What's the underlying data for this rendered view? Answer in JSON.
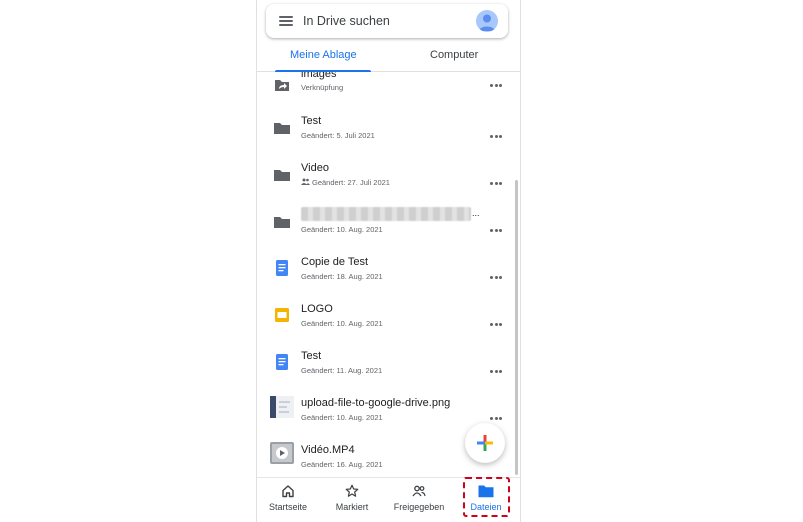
{
  "search": {
    "placeholder": "In Drive suchen"
  },
  "tabs": [
    {
      "label": "Meine Ablage",
      "active": true
    },
    {
      "label": "Computer",
      "active": false
    }
  ],
  "files": [
    {
      "name": "images",
      "sub": "Verknüpfung",
      "icon": "shortcut-icon",
      "shared": false
    },
    {
      "name": "Test",
      "sub": "Geändert: 5. Juli 2021",
      "icon": "folder-icon",
      "shared": false
    },
    {
      "name": "Video",
      "sub": "Geändert: 27. Juli 2021",
      "icon": "folder-icon",
      "shared": true
    },
    {
      "name": "...",
      "sub": "Geändert: 10. Aug. 2021",
      "icon": "folder-icon",
      "shared": false,
      "redacted": true
    },
    {
      "name": "Copie de Test",
      "sub": "Geändert: 18. Aug. 2021",
      "icon": "docs-icon",
      "shared": false
    },
    {
      "name": "LOGO",
      "sub": "Geändert: 10. Aug. 2021",
      "icon": "slides-icon",
      "shared": false
    },
    {
      "name": "Test",
      "sub": "Geändert: 11. Aug. 2021",
      "icon": "docs-icon",
      "shared": false
    },
    {
      "name": "upload-file-to-google-drive.png",
      "sub": "Geändert: 10. Aug. 2021",
      "icon": "image-thumbnail-icon",
      "shared": false
    },
    {
      "name": "Vidéo.MP4",
      "sub": "Geändert: 16. Aug. 2021",
      "icon": "video-thumbnail-icon",
      "shared": false
    }
  ],
  "nav": [
    {
      "label": "Startseite",
      "icon": "home-icon",
      "active": false
    },
    {
      "label": "Markiert",
      "icon": "star-icon",
      "active": false
    },
    {
      "label": "Freigegeben",
      "icon": "people-icon",
      "active": false
    },
    {
      "label": "Dateien",
      "icon": "folder-icon",
      "active": true
    }
  ],
  "colors": {
    "accent": "#1a73e8",
    "highlight": "#d0021b",
    "folder": "#5f6368",
    "docs": "#4285f4",
    "slides": "#f4b400"
  }
}
